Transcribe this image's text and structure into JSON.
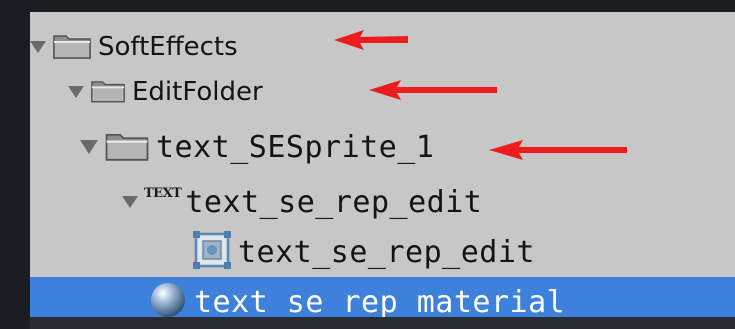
{
  "hierarchy": {
    "items": [
      {
        "label": "SoftEffects",
        "icon": "folder-icon",
        "expanded": true
      },
      {
        "label": "EditFolder",
        "icon": "folder-icon",
        "expanded": true
      },
      {
        "label": "text_SESprite_1",
        "icon": "folder-icon",
        "expanded": true
      },
      {
        "label": "text_se_rep_edit",
        "icon": "text-icon",
        "icon_text": "TEXT",
        "expanded": true
      },
      {
        "label": "text_se_rep_edit",
        "icon": "sprite-icon"
      },
      {
        "label": "text_se_rep_material",
        "icon": "material-sphere-icon",
        "selected": true
      }
    ]
  },
  "colors": {
    "panel_bg": "#c7c7c7",
    "selection": "#3d81dd",
    "annotation_arrow": "#ee1c1c",
    "background": "#1b1d22"
  }
}
